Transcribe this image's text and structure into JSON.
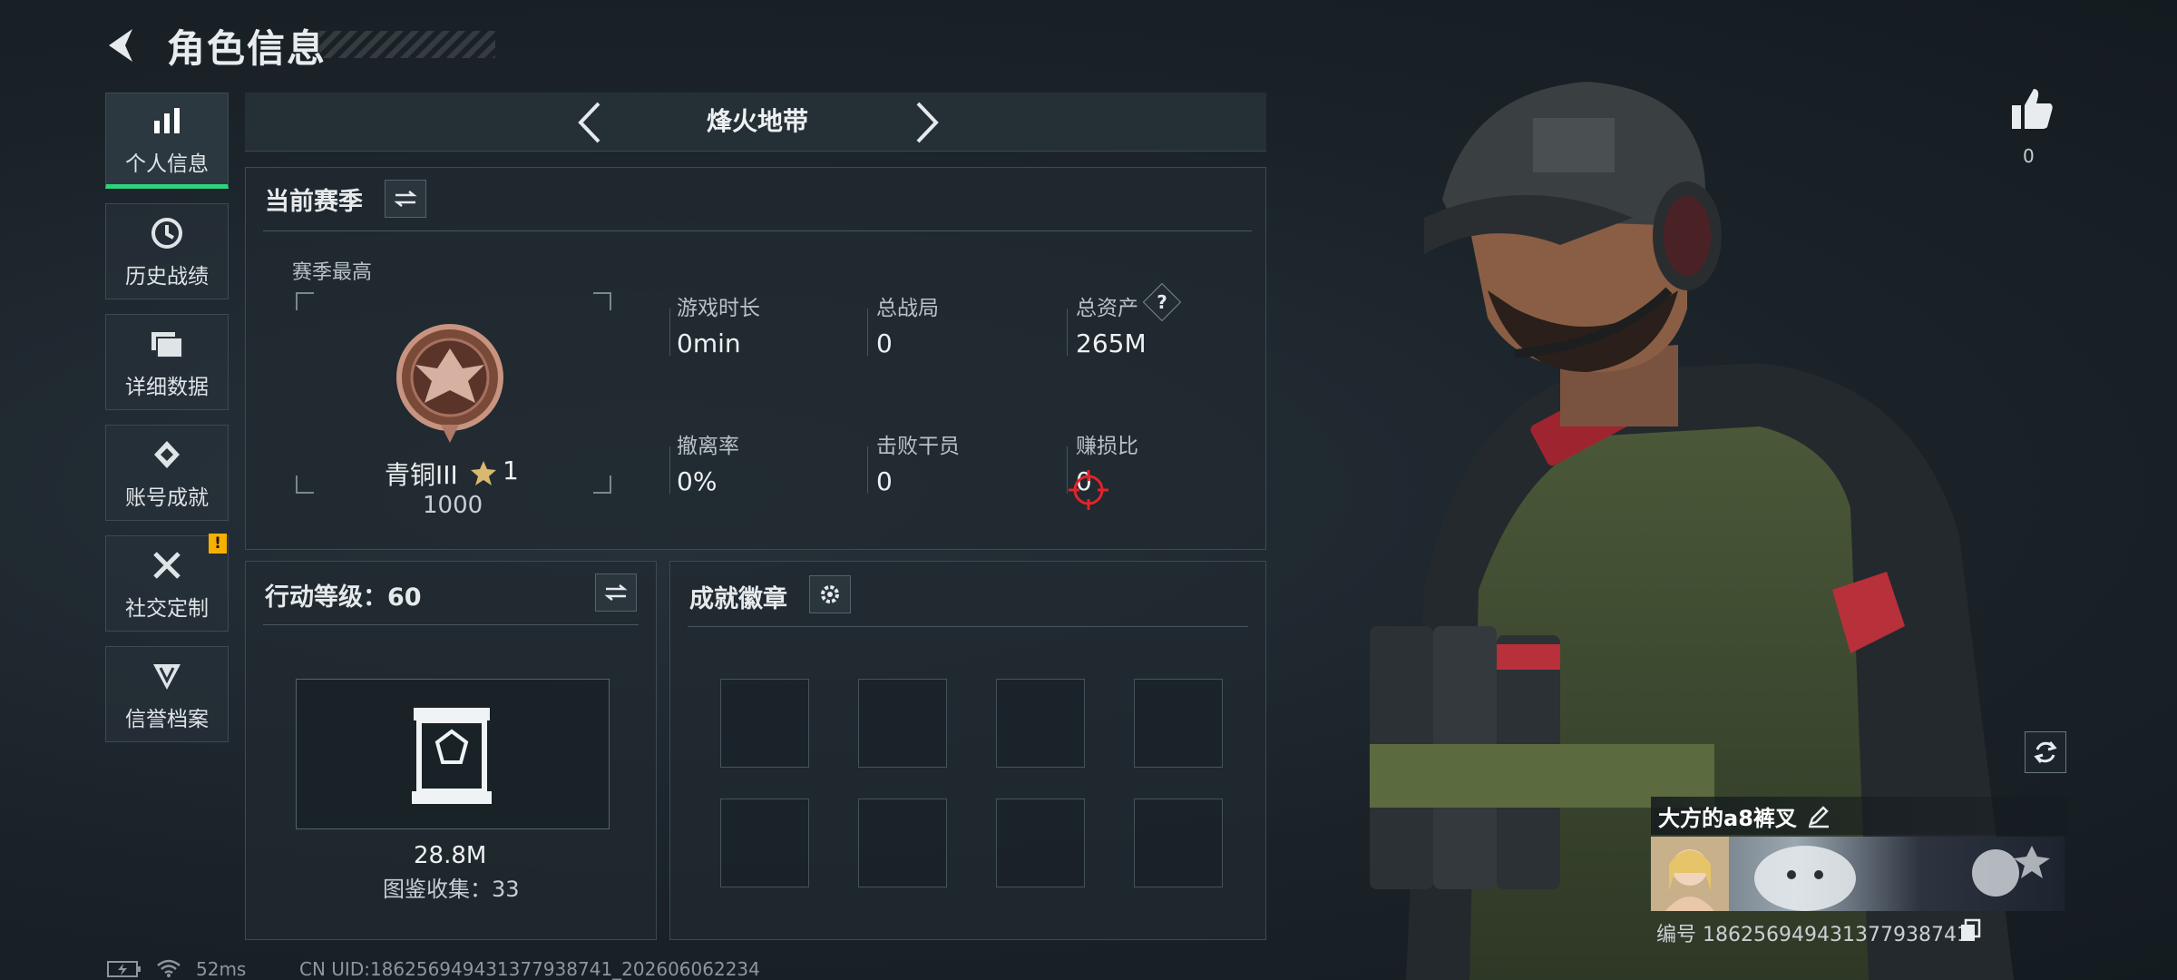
{
  "header": {
    "title": "角色信息"
  },
  "sidebar": {
    "items": [
      {
        "label": "个人信息",
        "icon": "bar-chart-icon"
      },
      {
        "label": "历史战绩",
        "icon": "history-clock-icon"
      },
      {
        "label": "详细数据",
        "icon": "folder-icon"
      },
      {
        "label": "账号成就",
        "icon": "achievement-icon"
      },
      {
        "label": "社交定制",
        "icon": "tools-icon"
      },
      {
        "label": "信誉档案",
        "icon": "shield-icon"
      }
    ],
    "warning_badge": "!"
  },
  "mode": {
    "label": "烽火地带"
  },
  "season": {
    "title": "当前赛季",
    "best_label": "赛季最高",
    "rank_name": "青铜III",
    "rank_stars": "1",
    "rank_points": "1000",
    "stats": [
      {
        "label": "游戏时长",
        "value": "0min"
      },
      {
        "label": "总战局",
        "value": "0"
      },
      {
        "label": "总资产",
        "value": "265M",
        "help": "?"
      },
      {
        "label": "撤离率",
        "value": "0%"
      },
      {
        "label": "击败干员",
        "value": "0"
      },
      {
        "label": "赚损比",
        "value": "0"
      }
    ]
  },
  "action_level": {
    "title": "行动等级：60",
    "value_text": "28.8M",
    "collection_text": "图鉴收集：33"
  },
  "achievements": {
    "title": "成就徽章",
    "slot_count": 8
  },
  "profile": {
    "like_count": "0",
    "player_name": "大方的a8裤叉",
    "id_text": "编号 1862569494313779387​41"
  },
  "footer": {
    "ping": "52ms",
    "uid": "CN UID:1862569494313779387​41_202606062234"
  },
  "colors": {
    "accent": "#2fd27d",
    "warning": "#f5b000",
    "crosshair": "#e0242a"
  }
}
